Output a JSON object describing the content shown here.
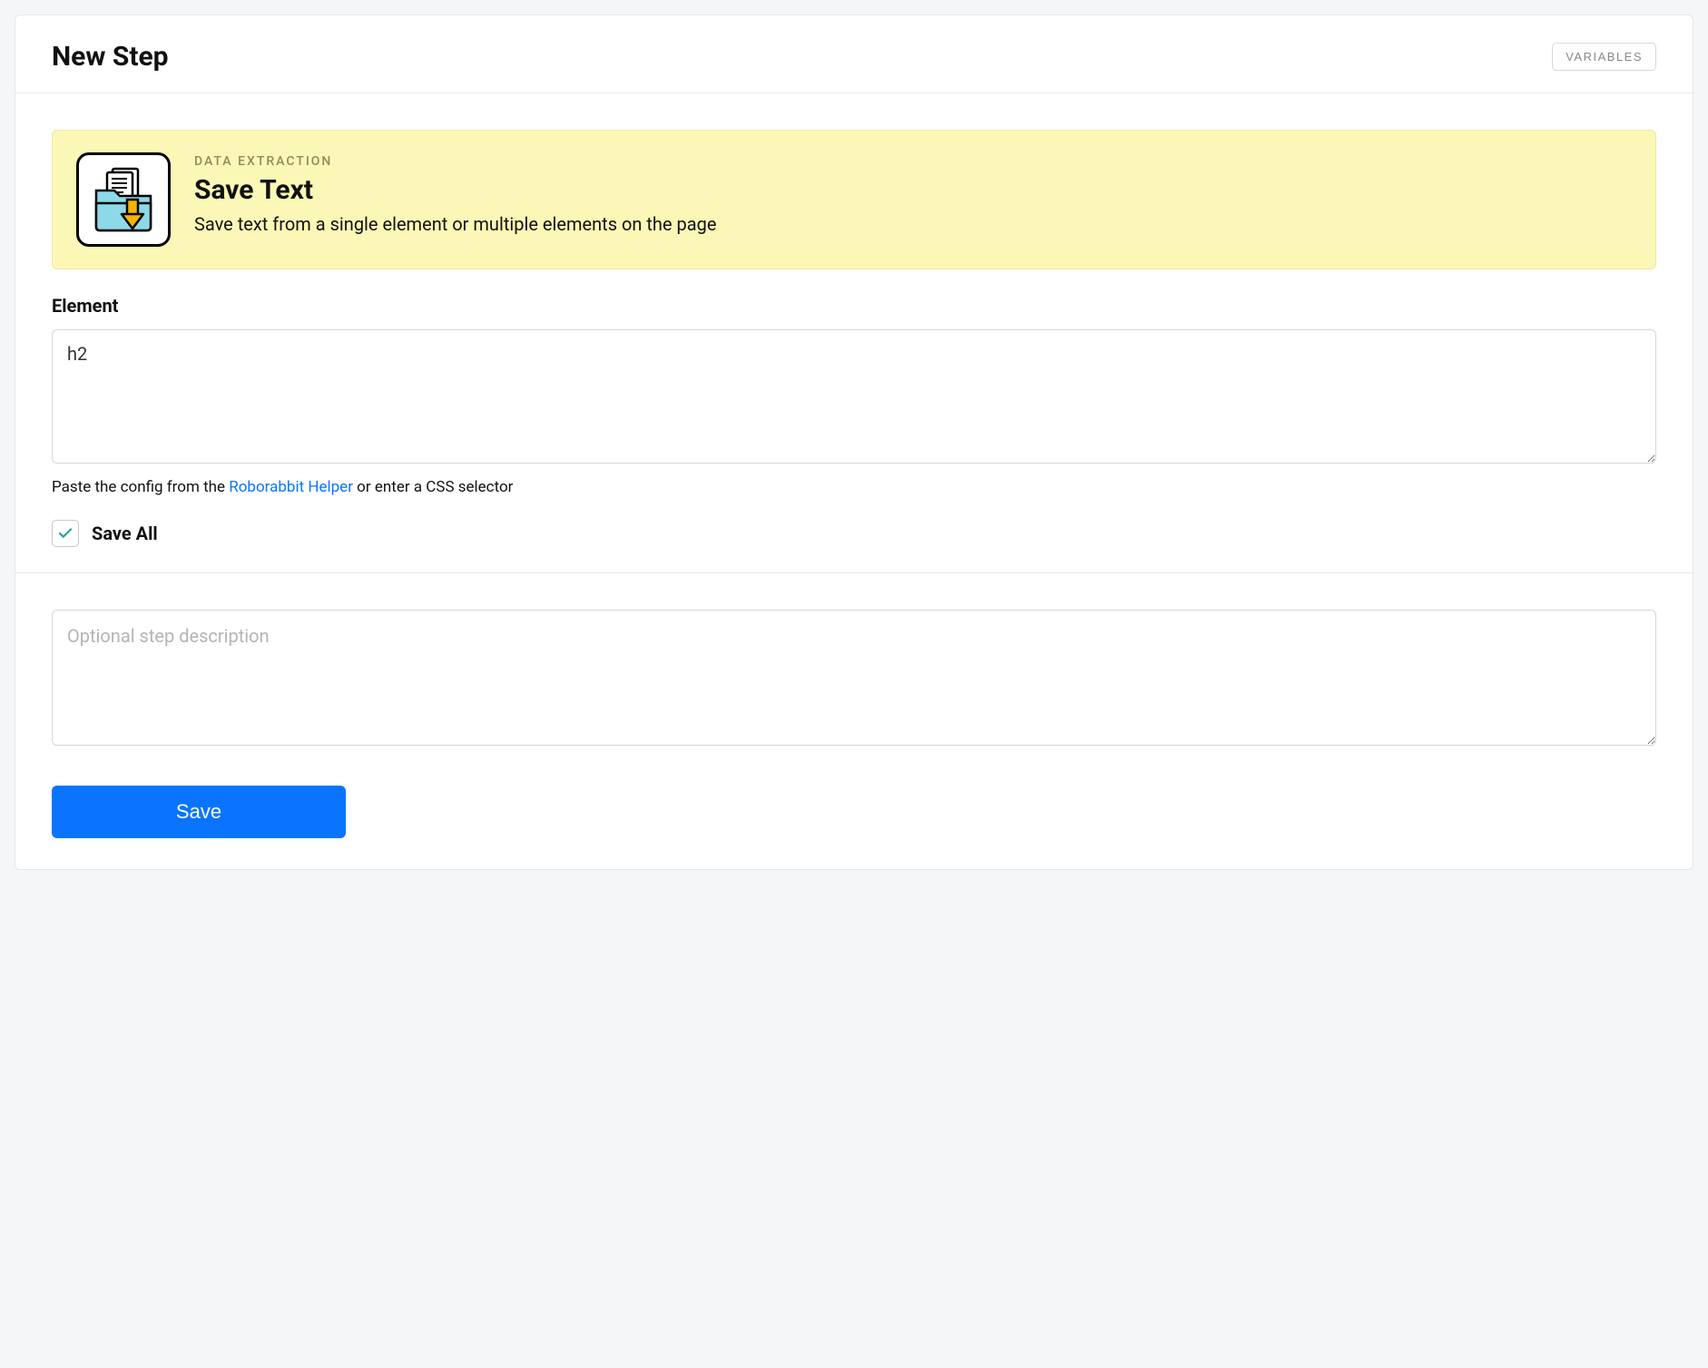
{
  "header": {
    "title": "New Step",
    "variables_label": "VARIABLES"
  },
  "info": {
    "category": "DATA EXTRACTION",
    "title": "Save Text",
    "description": "Save text from a single element or multiple elements on the page"
  },
  "element_field": {
    "label": "Element",
    "value": "h2",
    "hint_pre": "Paste the config from the ",
    "hint_link": "Roborabbit Helper",
    "hint_post": " or enter a CSS selector"
  },
  "save_all": {
    "label": "Save All",
    "checked": true
  },
  "footer": {
    "description_placeholder": "Optional step description",
    "save_label": "Save"
  }
}
